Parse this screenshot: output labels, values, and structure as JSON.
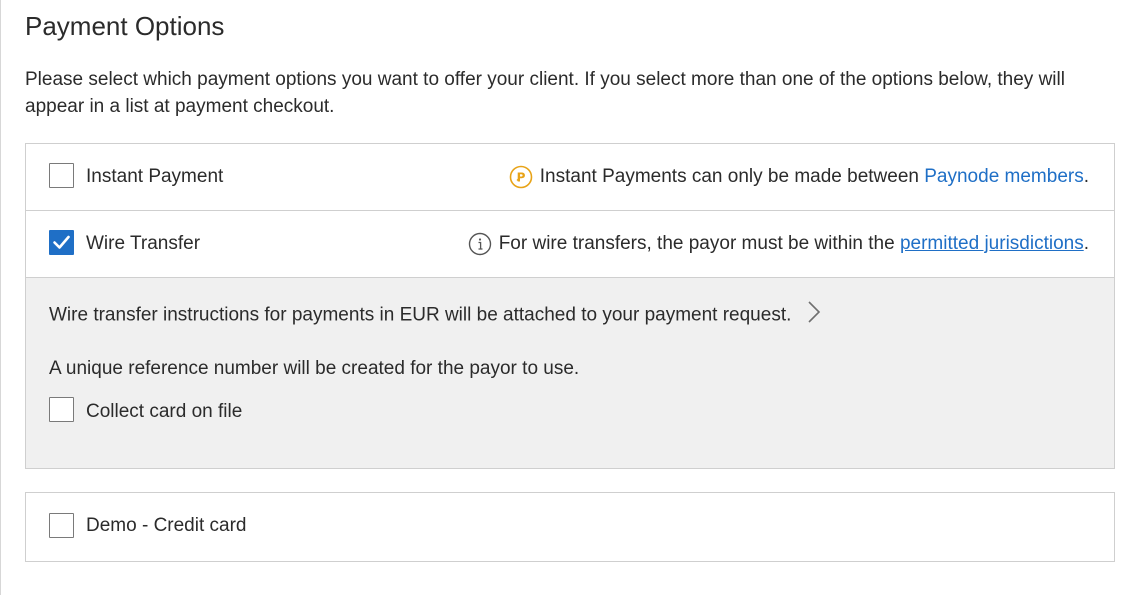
{
  "page": {
    "title": "Payment Options",
    "intro": "Please select which payment options you want to offer your client. If you select more than one of the options below, they will appear in a list at payment checkout."
  },
  "options": {
    "instant": {
      "label": "Instant Payment",
      "checked": false,
      "note_text": "Instant Payments can only be made between",
      "note_link": "Paynode members",
      "note_suffix": ".",
      "icon": "paynode-coin-icon"
    },
    "wire": {
      "label": "Wire Transfer",
      "checked": true,
      "note_text": "For wire transfers, the payor must be within the",
      "note_link": "permitted jurisdictions",
      "note_suffix": ".",
      "icon": "info-icon",
      "details": {
        "instructions": "Wire transfer instructions for payments in EUR will be attached to your payment request.",
        "reference": "A unique reference number will be created for the payor to use.",
        "collect_card_label": "Collect card on file",
        "collect_card_checked": false
      }
    },
    "demo": {
      "label": "Demo - Credit card",
      "checked": false
    }
  },
  "colors": {
    "link": "#1f6fc6",
    "checkbox_checked": "#1f6fc6",
    "coin_icon": "#e8a317",
    "panel_bg": "#f0f0f0",
    "border": "#cfcfcf"
  }
}
